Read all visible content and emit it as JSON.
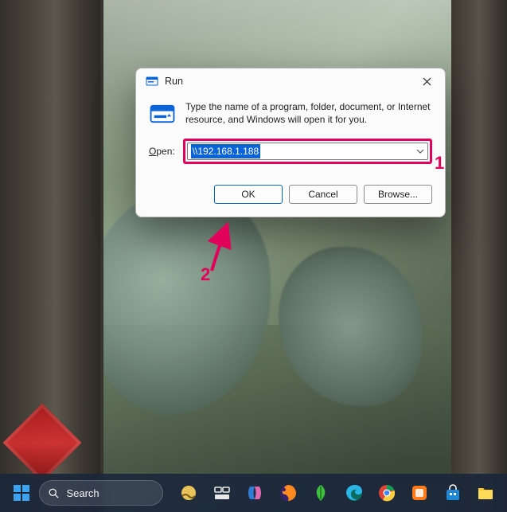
{
  "dialog": {
    "title": "Run",
    "description": "Type the name of a program, folder, document, or Internet resource, and Windows will open it for you.",
    "open_label_prefix": "O",
    "open_label_rest": "pen:",
    "input_value": "\\\\192.168.1.188",
    "buttons": {
      "ok": "OK",
      "cancel": "Cancel",
      "browse": "Browse..."
    }
  },
  "annotations": {
    "step1": "1",
    "step2": "2",
    "colors": {
      "accent": "#e1005a"
    }
  },
  "taskbar": {
    "search_placeholder": "Search"
  }
}
